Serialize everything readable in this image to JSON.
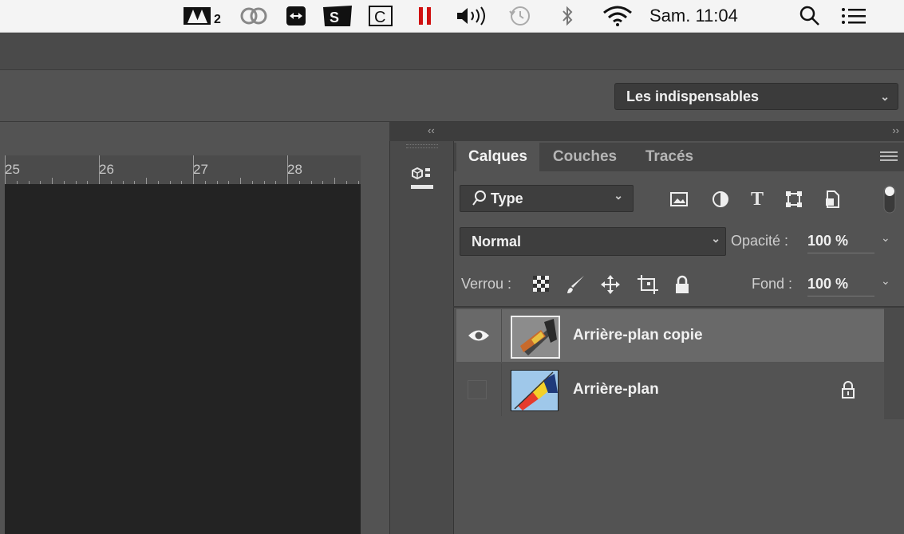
{
  "menubar": {
    "clock": "Sam. 11:04",
    "icons": [
      "adobe-icon",
      "creative-cloud-icon",
      "teamviewer-icon",
      "mixed-in-key-icon",
      "carbon-copy-icon",
      "parallels-icon",
      "volume-icon",
      "time-machine-icon",
      "bluetooth-icon",
      "wifi-icon",
      "spotlight-search-icon",
      "notification-center-icon"
    ]
  },
  "workspace": {
    "label": "Les indispensables"
  },
  "ruler": {
    "ticks": [
      "25",
      "26",
      "27",
      "28"
    ]
  },
  "panel": {
    "tabs": [
      "Calques",
      "Couches",
      "Tracés"
    ],
    "active_tab": "Calques",
    "filter": {
      "label": "Type"
    },
    "blend_mode": "Normal",
    "opacity_label": "Opacité :",
    "opacity_value": "100 %",
    "lock_label": "Verrou :",
    "fill_label": "Fond :",
    "fill_value": "100 %",
    "layers": [
      {
        "name": "Arrière-plan copie",
        "visible": true,
        "selected": true,
        "locked": false
      },
      {
        "name": "Arrière-plan",
        "visible": false,
        "selected": false,
        "locked": true
      }
    ]
  },
  "colors": {
    "panel_bg": "#535353",
    "selected_row": "#696969",
    "canvas": "#232323"
  }
}
